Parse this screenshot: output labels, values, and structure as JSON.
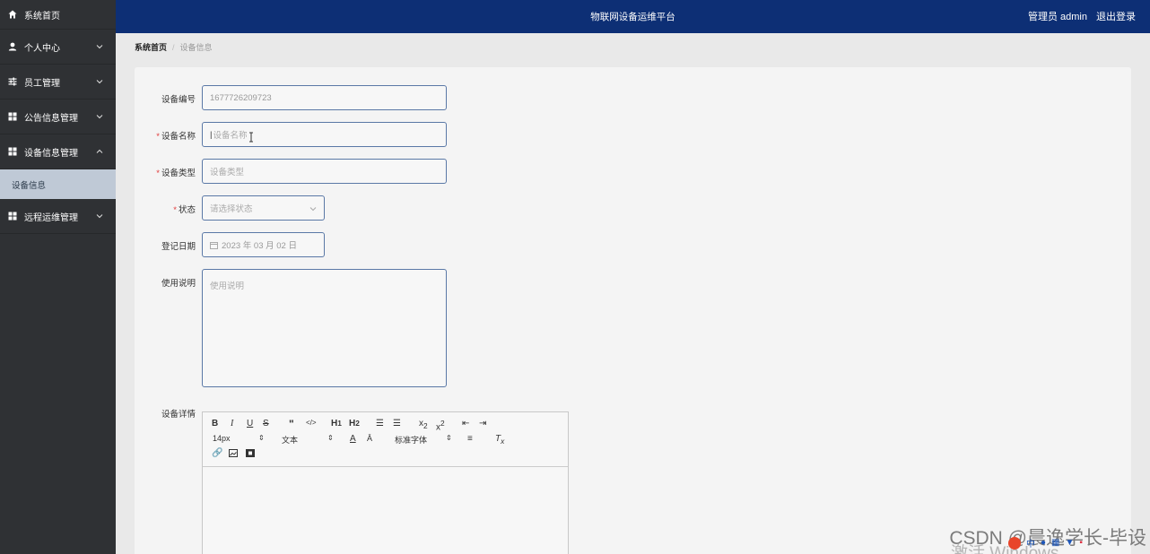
{
  "app": {
    "title": "物联网设备运维平台",
    "user_label": "管理员 admin",
    "logout_label": "退出登录"
  },
  "sidebar": {
    "home": "系统首页",
    "items": [
      {
        "label": "个人中心",
        "icon": "person-icon"
      },
      {
        "label": "员工管理",
        "icon": "sliders-icon"
      },
      {
        "label": "公告信息管理",
        "icon": "grid-icon"
      },
      {
        "label": "设备信息管理",
        "icon": "grid-icon"
      },
      {
        "label": "远程运维管理",
        "icon": "grid-icon"
      }
    ],
    "sub_item": "设备信息"
  },
  "breadcrumb": {
    "home": "系统首页",
    "current": "设备信息"
  },
  "form": {
    "device_no": {
      "label": "设备编号",
      "value": "1677726209723"
    },
    "device_name": {
      "label": "设备名称",
      "placeholder": "设备名称"
    },
    "device_type": {
      "label": "设备类型",
      "placeholder": "设备类型"
    },
    "status": {
      "label": "状态",
      "placeholder": "请选择状态"
    },
    "reg_date": {
      "label": "登记日期",
      "value": "2023 年 03 月 02 日"
    },
    "usage": {
      "label": "使用说明",
      "placeholder": "使用说明"
    },
    "detail": {
      "label": "设备详情"
    }
  },
  "editor": {
    "font_size": "14px",
    "block_format": "文本",
    "font_family": "标准字体"
  },
  "watermark": {
    "csdn": "CSDN @晨逸学长-毕设",
    "windows": "激活 Windows"
  },
  "colors": {
    "header_bg": "#0d2f75",
    "sidebar_bg": "#2f3134",
    "active_sub_bg": "#bfc9d6",
    "required": "#e03a3a",
    "input_border": "#5a78a6"
  }
}
